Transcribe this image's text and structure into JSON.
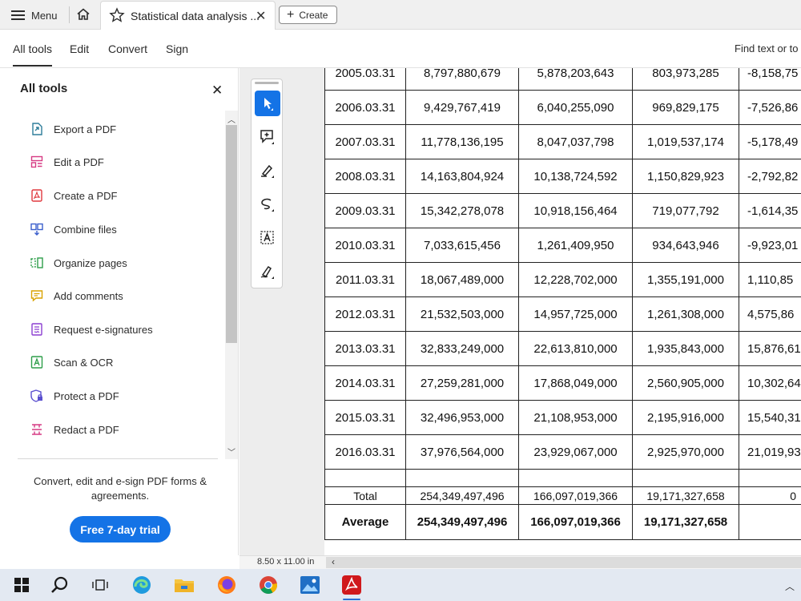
{
  "tabbar": {
    "menu_label": "Menu",
    "doc_tab_title": "Statistical data analysis ...",
    "create_label": "Create"
  },
  "toolbar": {
    "tabs": [
      "All tools",
      "Edit",
      "Convert",
      "Sign"
    ],
    "active_tab": "All tools",
    "find_placeholder": "Find text or to"
  },
  "panel": {
    "title": "All tools",
    "tools": [
      {
        "label": "Export a PDF",
        "icon": "export-pdf-icon",
        "color": "#2e7d9a"
      },
      {
        "label": "Edit a PDF",
        "icon": "edit-pdf-icon",
        "color": "#d63a83"
      },
      {
        "label": "Create a PDF",
        "icon": "create-pdf-icon",
        "color": "#e0393e"
      },
      {
        "label": "Combine files",
        "icon": "combine-files-icon",
        "color": "#3b5fcc"
      },
      {
        "label": "Organize pages",
        "icon": "organize-pages-icon",
        "color": "#2e9e4a"
      },
      {
        "label": "Add comments",
        "icon": "add-comments-icon",
        "color": "#d9a300"
      },
      {
        "label": "Request e-signatures",
        "icon": "request-esignatures-icon",
        "color": "#8c3fd1"
      },
      {
        "label": "Scan & OCR",
        "icon": "scan-ocr-icon",
        "color": "#2e9e4a"
      },
      {
        "label": "Protect a PDF",
        "icon": "protect-pdf-icon",
        "color": "#5a4fcf"
      },
      {
        "label": "Redact a PDF",
        "icon": "redact-pdf-icon",
        "color": "#d63a83"
      }
    ],
    "promo_text": "Convert, edit and e-sign PDF forms & agreements.",
    "trial_button": "Free 7-day trial"
  },
  "document": {
    "rows": [
      [
        "2005.03.31",
        "8,797,880,679",
        "5,878,203,643",
        "803,973,285",
        "-8,158,75"
      ],
      [
        "2006.03.31",
        "9,429,767,419",
        "6,040,255,090",
        "969,829,175",
        "-7,526,86"
      ],
      [
        "2007.03.31",
        "11,778,136,195",
        "8,047,037,798",
        "1,019,537,174",
        "-5,178,49"
      ],
      [
        "2008.03.31",
        "14,163,804,924",
        "10,138,724,592",
        "1,150,829,923",
        "-2,792,82"
      ],
      [
        "2009.03.31",
        "15,342,278,078",
        "10,918,156,464",
        "719,077,792",
        "-1,614,35"
      ],
      [
        "2010.03.31",
        "7,033,615,456",
        "1,261,409,950",
        "934,643,946",
        "-9,923,01"
      ],
      [
        "2011.03.31",
        "18,067,489,000",
        "12,228,702,000",
        "1,355,191,000",
        "1,110,85"
      ],
      [
        "2012.03.31",
        "21,532,503,000",
        "14,957,725,000",
        "1,261,308,000",
        "4,575,86"
      ],
      [
        "2013.03.31",
        "32,833,249,000",
        "22,613,810,000",
        "1,935,843,000",
        "15,876,61"
      ],
      [
        "2014.03.31",
        "27,259,281,000",
        "17,868,049,000",
        "2,560,905,000",
        "10,302,64"
      ],
      [
        "2015.03.31",
        "32,496,953,000",
        "21,108,953,000",
        "2,195,916,000",
        "15,540,31"
      ],
      [
        "2016.03.31",
        "37,976,564,000",
        "23,929,067,000",
        "2,925,970,000",
        "21,019,93"
      ]
    ],
    "total_row": [
      "Total",
      "254,349,497,496",
      "166,097,019,366",
      "19,171,327,658",
      "0"
    ],
    "average_row": [
      "Average",
      "254,349,497,496",
      "166,097,019,366",
      "19,171,327,658",
      ""
    ],
    "page_size": "8.50 x 11.00 in"
  },
  "floating_tools": [
    "select-cursor-icon",
    "add-comment-icon",
    "highlight-pen-icon",
    "draw-freeform-icon",
    "text-select-icon",
    "fill-sign-icon"
  ],
  "colors": {
    "accent": "#1473e6",
    "acrobat_red": "#d0191c"
  }
}
